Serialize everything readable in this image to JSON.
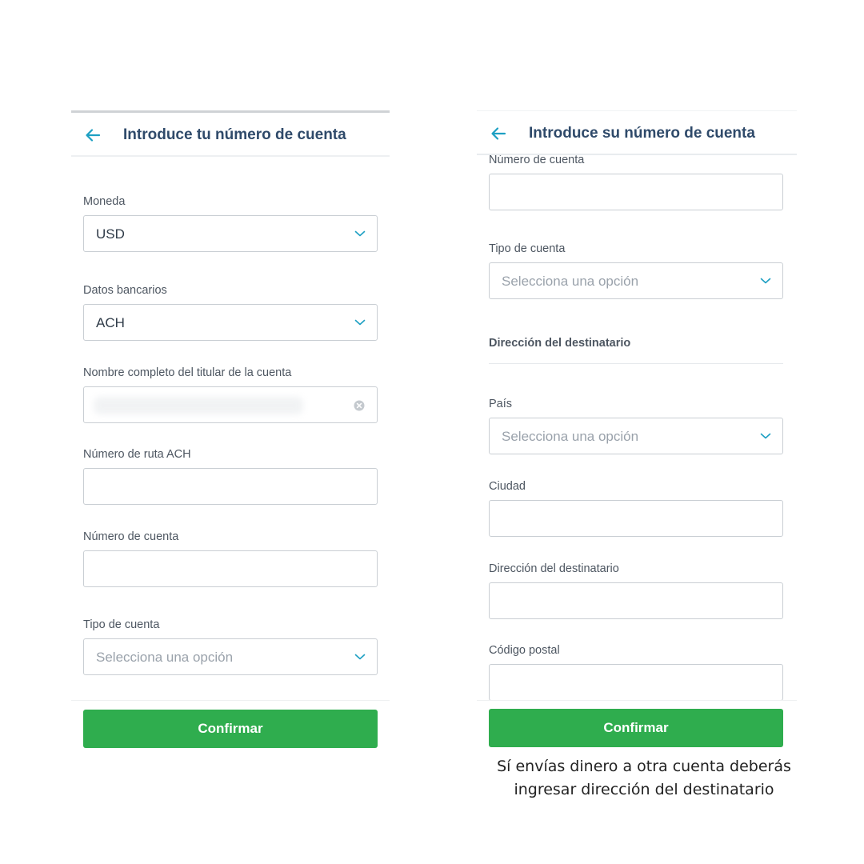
{
  "left": {
    "title": "Introduce tu número de cuenta",
    "fields": {
      "currency_label": "Moneda",
      "currency_value": "USD",
      "bank_label": "Datos bancarios",
      "bank_value": "ACH",
      "holder_label": "Nombre completo del titular de la cuenta",
      "routing_label": "Número de ruta ACH",
      "account_label": "Número de cuenta",
      "type_label": "Tipo de cuenta",
      "type_placeholder": "Selecciona una opción"
    },
    "confirm_label": "Confirmar"
  },
  "right": {
    "title": "Introduce su número de cuenta",
    "fields": {
      "account_label": "Número de cuenta",
      "type_label": "Tipo de cuenta",
      "type_placeholder": "Selecciona una opción",
      "address_section": "Dirección del destinatario",
      "country_label": "País",
      "country_placeholder": "Selecciona una opción",
      "city_label": "Ciudad",
      "address_label": "Dirección del destinatario",
      "postal_label": "Código postal"
    },
    "confirm_label": "Confirmar"
  },
  "caption": {
    "line1": "Sí envías dinero a otra cuenta deberás",
    "line2": "ingresar dirección del destinatario"
  },
  "colors": {
    "accent": "#1ea0c3",
    "button": "#2fad4e",
    "title": "#2f4a6a"
  },
  "icons": {
    "back": "arrow-left-icon",
    "dropdown": "chevron-down-icon",
    "clear": "clear-circle-icon"
  }
}
